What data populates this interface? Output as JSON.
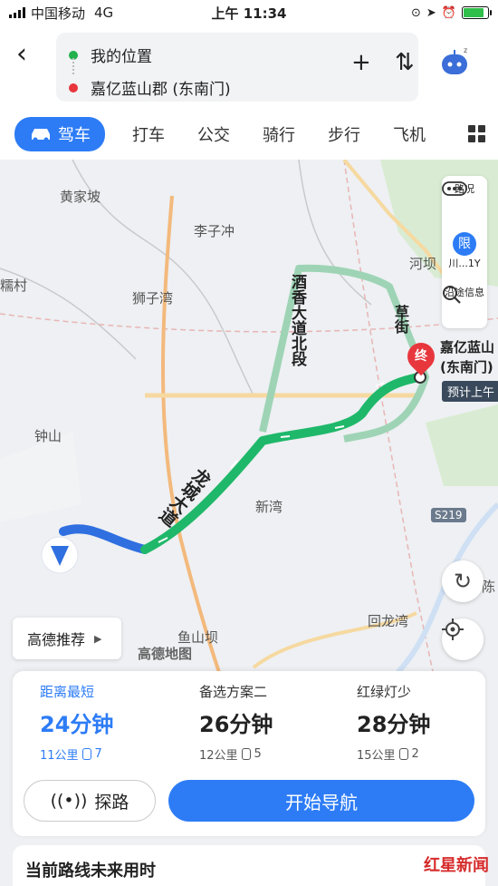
{
  "status_bar": {
    "carrier": "中国移动",
    "network": "4G",
    "time": "上午 11:34"
  },
  "header": {
    "origin": "我的位置",
    "destination": "嘉亿蓝山郡 (东南门)",
    "origin_color": "#22b14c",
    "destination_color": "#e8363d"
  },
  "tabs": {
    "drive": "驾车",
    "taxi": "打车",
    "transit": "公交",
    "bike": "骑行",
    "walk": "步行",
    "flight": "飞机"
  },
  "map": {
    "places": {
      "huangjiapo": "黄家坡",
      "liziichong": "李子冲",
      "shiziwan": "狮子湾",
      "heba": "河坝",
      "zhongshan": "钟山",
      "xinwan": "新湾",
      "yushanba": "鱼山坝",
      "huilongwan": "回龙湾",
      "chen": "陈",
      "nuocun": "糯村",
      "cao_jie": "草街"
    },
    "roads": {
      "jiuxiang": "酒香大道北段",
      "longcheng": "龙城大道"
    },
    "route_badge": "S219",
    "destination_pin": "终",
    "destination_label_line1": "嘉亿蓝山",
    "destination_label_line2": "(东南门)",
    "eta_tag": "预计上午",
    "brand": "高德地图",
    "recommend_button": "高德推荐",
    "side_panel": {
      "traffic": "路况",
      "limit_icon": "限",
      "limit_label": "川...1Y",
      "along_route": "沿途信息"
    },
    "colors": {
      "route_fast": "#1fb86a",
      "route_slow": "#2f6fe0"
    }
  },
  "plans": [
    {
      "label": "距离最短",
      "duration": "24分钟",
      "distance": "11公里",
      "lights": "7"
    },
    {
      "label": "备选方案二",
      "duration": "26分钟",
      "distance": "12公里",
      "lights": "5"
    },
    {
      "label": "红绿灯少",
      "duration": "28分钟",
      "distance": "15公里",
      "lights": "2"
    }
  ],
  "actions": {
    "explore": "探路",
    "start_navigation": "开始导航"
  },
  "footer": {
    "text": "当前路线未来用时"
  },
  "watermark": "红星新闻"
}
